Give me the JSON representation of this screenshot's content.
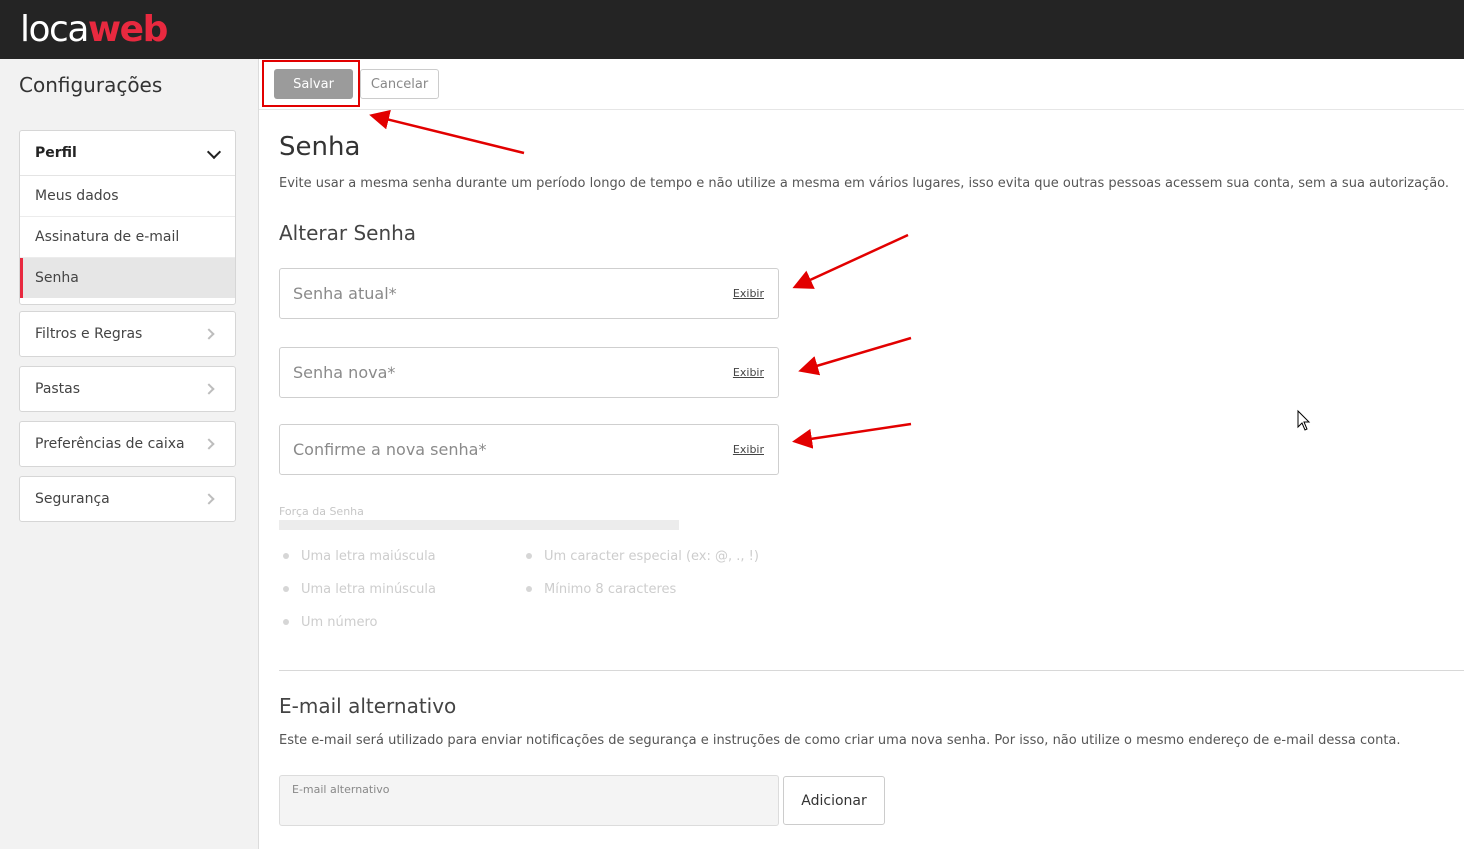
{
  "header": {
    "logo_part1": "loca",
    "logo_part2": "web"
  },
  "sidebar": {
    "title": "Configurações",
    "profile_group": {
      "label": "Perfil",
      "items": [
        {
          "label": "Meus dados"
        },
        {
          "label": "Assinatura de e-mail"
        },
        {
          "label": "Senha"
        }
      ]
    },
    "groups": [
      {
        "label": "Filtros e Regras"
      },
      {
        "label": "Pastas"
      },
      {
        "label": "Preferências de caixa"
      },
      {
        "label": "Segurança"
      }
    ]
  },
  "toolbar": {
    "save_label": "Salvar",
    "cancel_label": "Cancelar"
  },
  "password": {
    "title": "Senha",
    "description": "Evite usar a mesma senha durante um período longo de tempo e não utilize a mesma em vários lugares, isso evita que outras pessoas acessem sua conta, sem a sua autorização.",
    "change_title": "Alterar Senha",
    "fields": [
      {
        "placeholder": "Senha atual*",
        "toggle": "Exibir"
      },
      {
        "placeholder": "Senha nova*",
        "toggle": "Exibir"
      },
      {
        "placeholder": "Confirme a nova senha*",
        "toggle": "Exibir"
      }
    ],
    "strength_label": "Força da Senha",
    "requirements": [
      "Uma letra maiúscula",
      "Uma letra minúscula",
      "Um número",
      "Um caracter especial (ex: @, ., !)",
      "Mínimo 8 caracteres"
    ]
  },
  "alt_email": {
    "title": "E-mail alternativo",
    "description": "Este e-mail será utilizado para enviar notificações de segurança e instruções de como criar uma nova senha. Por isso, não utilize o mesmo endereço de e-mail dessa conta.",
    "field_label": "E-mail alternativo",
    "add_label": "Adicionar"
  },
  "colors": {
    "brand_red": "#e8293f",
    "annotation_red": "#e20000",
    "topbar": "#242424"
  }
}
